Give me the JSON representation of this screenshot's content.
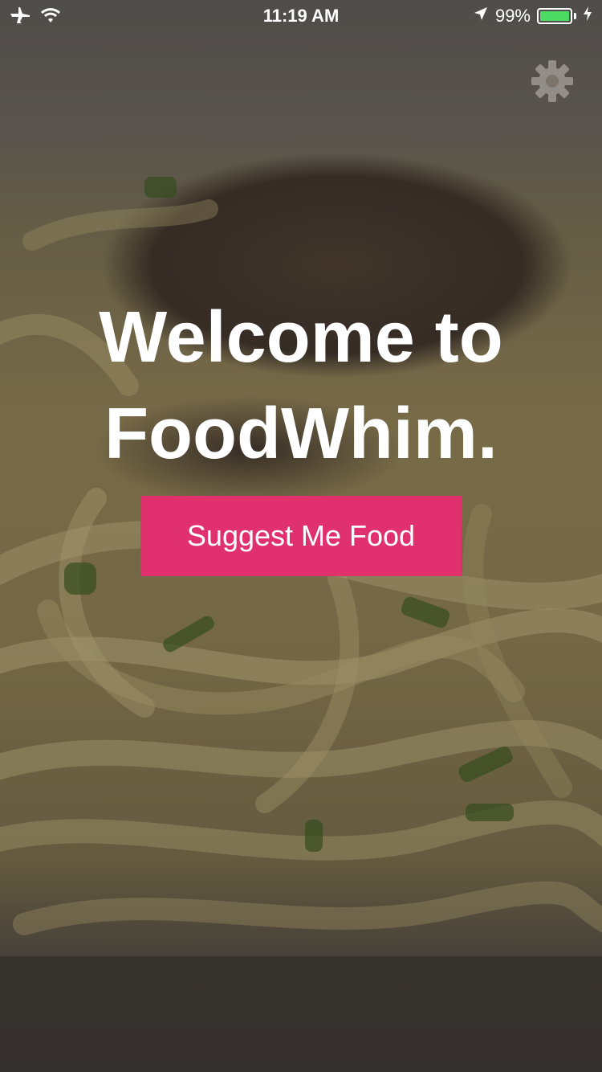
{
  "status_bar": {
    "time": "11:19 AM",
    "battery_percent_label": "99%",
    "battery_level": 0.99,
    "icons": [
      "airplane-icon",
      "wifi-icon",
      "location-arrow-icon",
      "battery-icon",
      "charging-bolt-icon"
    ],
    "battery_color": "#4cd964"
  },
  "header": {
    "settings_icon": "gear-icon"
  },
  "hero": {
    "line1": "Welcome to",
    "line2": "FoodWhim."
  },
  "cta": {
    "label": "Suggest Me Food",
    "color": "#e0316e"
  },
  "background": {
    "description_icon": "pasta-photo"
  }
}
